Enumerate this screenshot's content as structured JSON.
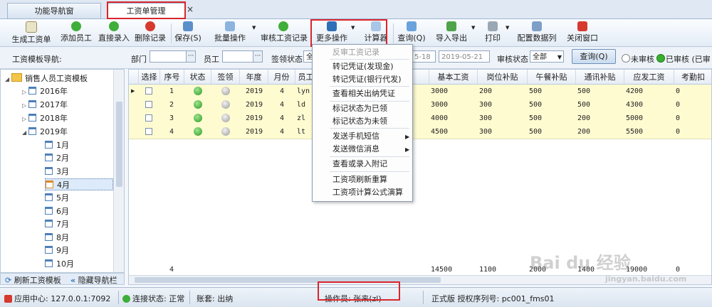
{
  "tabs": {
    "nav": "功能导航窗",
    "payroll": "工资单管理",
    "close": "×"
  },
  "toolbar": {
    "items": [
      "生成工资单",
      "添加员工",
      "直接录入",
      "删除记录",
      "保存(S)",
      "批量操作",
      "审核工资记录",
      "更多操作",
      "计算器",
      "查询(Q)",
      "导入导出",
      "打印",
      "配置数据列",
      "关闭窗口"
    ],
    "colors": {
      "accent": "#2f6fb8",
      "highlight": "#d9262c"
    }
  },
  "filter": {
    "nav_label": "工资模板导航:",
    "dept_label": "部门",
    "emp_label": "员工",
    "sign_label": "签领状态",
    "sign_value": "全",
    "date_from": "5-18",
    "date_to": "2019-05-21",
    "audit_label": "审核状态",
    "audit_value": "全部",
    "query": "查询(Q)",
    "unaudited": "未审核",
    "audited": "已审核 (已审"
  },
  "tree": {
    "root": "销售人员工资模板",
    "years": [
      "2016年",
      "2017年",
      "2018年",
      "2019年"
    ],
    "months": [
      "1月",
      "2月",
      "3月",
      "4月",
      "5月",
      "6月",
      "7月",
      "8月",
      "9月",
      "10月"
    ],
    "selected": "4月",
    "refresh": "刷新工资模板",
    "hide": "隐藏导航栏"
  },
  "grid": {
    "headers": [
      "选择",
      "序号",
      "状态",
      "签领",
      "年度",
      "月份",
      "员工",
      "",
      "基本工资",
      "岗位补贴",
      "午餐补贴",
      "通讯补贴",
      "应发工资",
      "考勤扣"
    ],
    "rows": [
      {
        "no": "1",
        "year": "2019",
        "month": "4",
        "emp": "lyn",
        "base": "3000",
        "post": "200",
        "lunch": "500",
        "comm": "500",
        "gross": "4200",
        "att": "0"
      },
      {
        "no": "2",
        "year": "2019",
        "month": "4",
        "emp": "ld",
        "base": "3000",
        "post": "300",
        "lunch": "500",
        "comm": "500",
        "gross": "4300",
        "att": "0"
      },
      {
        "no": "3",
        "year": "2019",
        "month": "4",
        "emp": "zl",
        "base": "4000",
        "post": "300",
        "lunch": "500",
        "comm": "200",
        "gross": "5000",
        "att": "0"
      },
      {
        "no": "4",
        "year": "2019",
        "month": "4",
        "emp": "lt",
        "base": "4500",
        "post": "300",
        "lunch": "500",
        "comm": "200",
        "gross": "5500",
        "att": "0"
      }
    ],
    "footer": {
      "count": "4",
      "base": "14500",
      "post": "1100",
      "lunch": "2000",
      "comm": "1400",
      "gross": "19000",
      "att": "0"
    }
  },
  "menu": {
    "disabled": "反审工资记录",
    "items": [
      "转记凭证(发现金)",
      "转记凭证(银行代发)",
      "查看相关出纳凭证",
      "标记状态为已领",
      "标记状态为未领",
      "发送手机短信",
      "发送微信消息",
      "查看或录入附记",
      "工资项刷新重算",
      "工资项计算公式演算"
    ]
  },
  "status": {
    "app_center": "应用中心: 127.0.0.1:7092",
    "conn": "连接状态: 正常",
    "account": "账套: 出纳",
    "operator": "操作员: 张来(zl)",
    "version": "正式版 授权序列号: pc001_fms01"
  },
  "watermark": {
    "brand": "Bai du 经验",
    "url": "jingyan.baidu.com"
  }
}
